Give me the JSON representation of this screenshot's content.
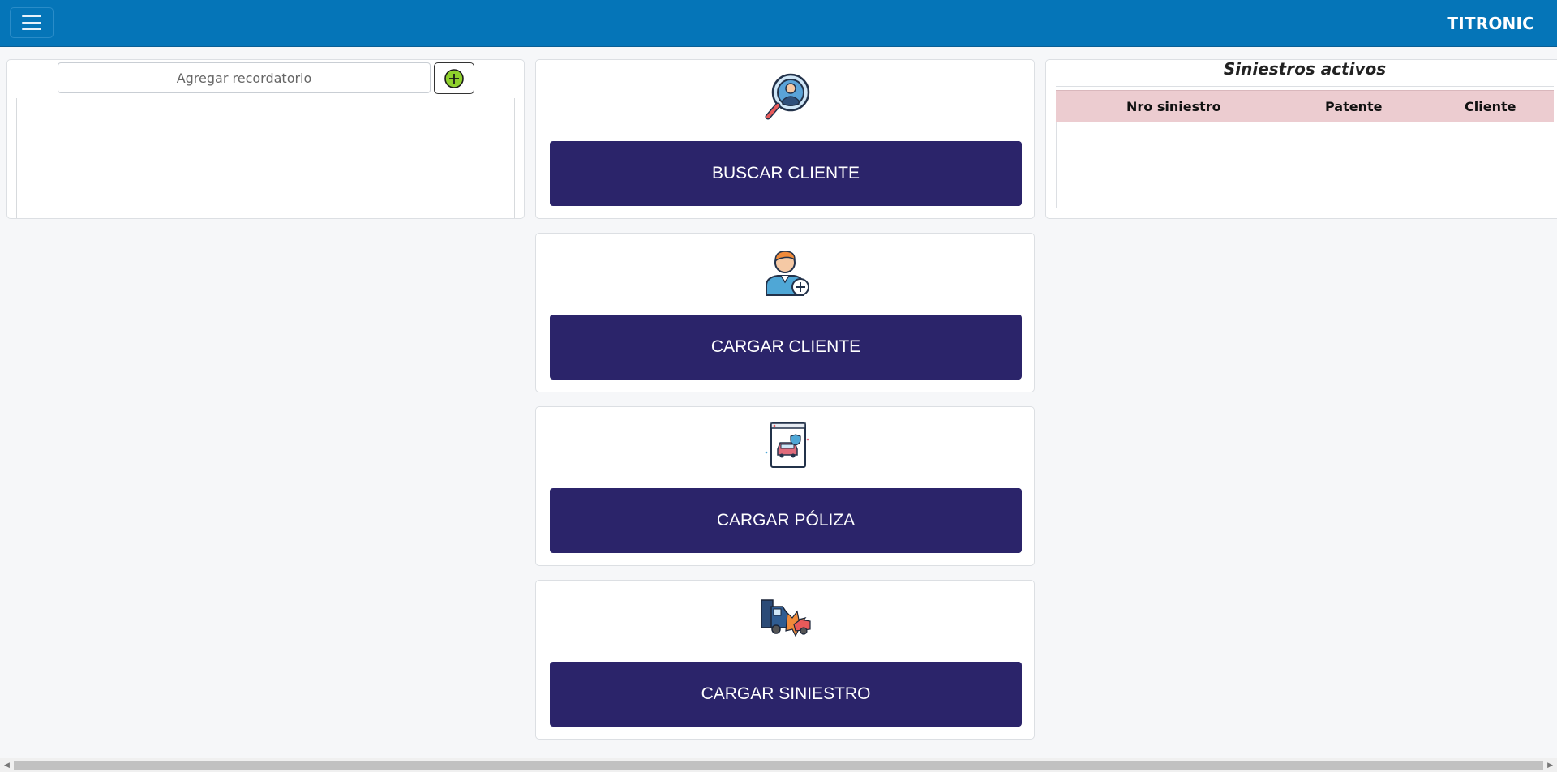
{
  "navbar": {
    "brand": "TITRONIC",
    "menu_icon": "hamburger-icon"
  },
  "reminders": {
    "placeholder": "Agregar recordatorio",
    "add_icon": "plus-circle-icon"
  },
  "actions": [
    {
      "label": "BUSCAR CLIENTE",
      "icon": "search-client-icon"
    },
    {
      "label": "CARGAR CLIENTE",
      "icon": "add-user-icon"
    },
    {
      "label": "CARGAR PÓLIZA",
      "icon": "car-policy-icon"
    },
    {
      "label": "CARGAR SINIESTRO",
      "icon": "car-crash-icon"
    }
  ],
  "siniestros": {
    "title": "Siniestros activos",
    "columns": [
      "Nro siniestro",
      "Patente",
      "Cliente"
    ],
    "rows": []
  },
  "colors": {
    "navbar": "#0575b8",
    "button": "#2b246a",
    "table_header": "#ecccd0",
    "add_button_fill": "#8fd12c"
  }
}
